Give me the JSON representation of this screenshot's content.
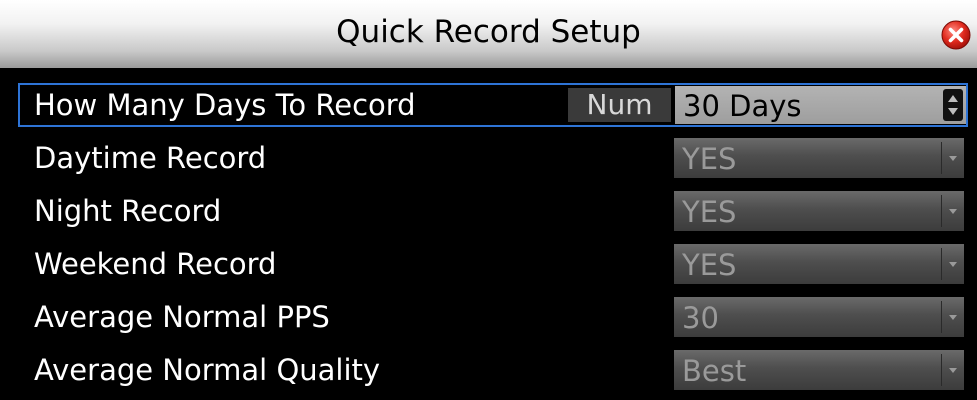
{
  "dialog": {
    "title": "Quick Record Setup",
    "close_icon": "close-icon",
    "accent_color": "#2e74d6"
  },
  "rows": [
    {
      "label": "How Many Days To Record",
      "input_mode": "Num",
      "value": "30 Days",
      "control": "spinner"
    },
    {
      "label": "Daytime Record",
      "value": "YES",
      "control": "dropdown"
    },
    {
      "label": "Night Record",
      "value": "YES",
      "control": "dropdown"
    },
    {
      "label": "Weekend Record",
      "value": "YES",
      "control": "dropdown"
    },
    {
      "label": "Average Normal PPS",
      "value": "30",
      "control": "dropdown"
    },
    {
      "label": "Average Normal Quality",
      "value": "Best",
      "control": "dropdown"
    }
  ]
}
